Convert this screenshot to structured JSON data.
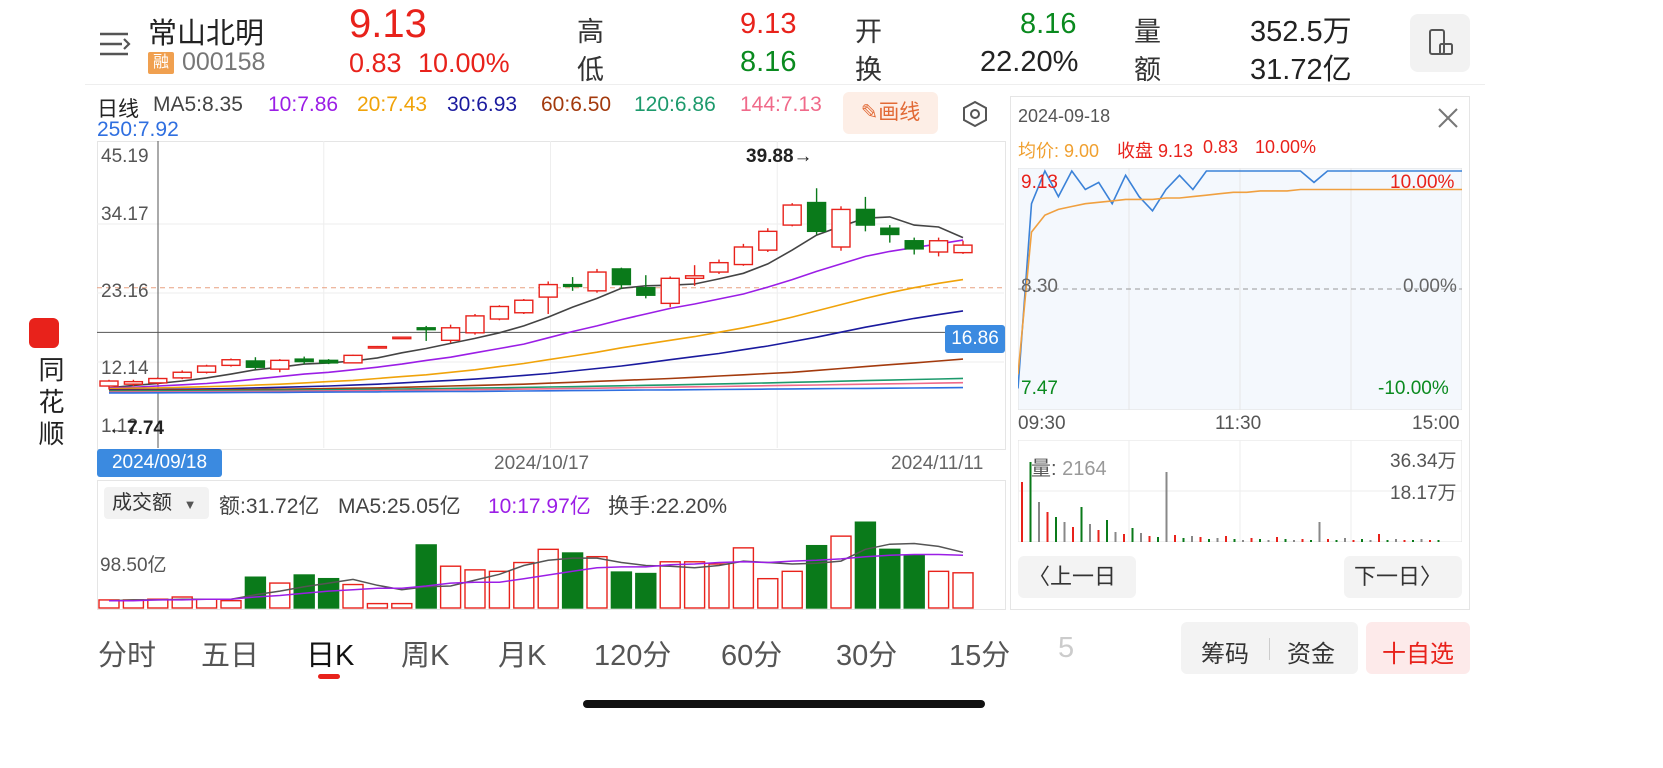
{
  "stock": {
    "name": "常山北明",
    "tag": "融",
    "code": "000158",
    "price": "9.13",
    "change": "0.83",
    "change_pct": "10.00%",
    "high_label": "高",
    "high": "9.13",
    "low_label": "低",
    "low": "8.16",
    "open_label": "开",
    "open": "8.16",
    "turnover_label": "换",
    "turnover": "22.20%",
    "volume_label": "量",
    "volume": "352.5万",
    "amount_label": "额",
    "amount": "31.72亿"
  },
  "brand": {
    "name": "同花顺"
  },
  "kline": {
    "period": "日线",
    "ma": [
      {
        "label": "MA5:8.35",
        "color": "#444444"
      },
      {
        "label": "10:7.86",
        "color": "#9b1ee6"
      },
      {
        "label": "20:7.43",
        "color": "#f0a30a"
      },
      {
        "label": "30:6.93",
        "color": "#1a1a9e"
      },
      {
        "label": "60:6.50",
        "color": "#a33a0d"
      },
      {
        "label": "120:6.86",
        "color": "#1d9a6c"
      },
      {
        "label": "144:7.13",
        "color": "#f06a8a"
      }
    ],
    "ma250": {
      "label": "250:7.92",
      "color": "#2f6fe0"
    },
    "draw_button": "画线",
    "y_ticks": [
      "45.19",
      "34.17",
      "23.16",
      "12.14",
      "1.12"
    ],
    "max_label": "39.88→",
    "min_label": "←7.74",
    "crosshair_value": "16.86",
    "dates": [
      "2024/09/18",
      "2024/10/17",
      "2024/11/11"
    ],
    "volume_indicator": "成交额",
    "volume_stats": {
      "amount": "额:31.72亿",
      "ma5": "MA5:25.05亿",
      "ma10": "10:17.97亿",
      "turnover": "换手:22.20%"
    },
    "volume_tick": "98.50亿"
  },
  "chart_data": [
    {
      "type": "candlestick",
      "title": "",
      "ylim": [
        1.12,
        45.19
      ],
      "dates": [
        "2024/09/18",
        "2024/10/17",
        "2024/11/11"
      ],
      "candles": [
        {
          "o": 8.3,
          "c": 9.1,
          "h": 9.3,
          "l": 7.74
        },
        {
          "o": 8.6,
          "c": 9.0,
          "h": 9.3,
          "l": 8.3
        },
        {
          "o": 8.8,
          "c": 9.5,
          "h": 9.7,
          "l": 8.5
        },
        {
          "o": 9.6,
          "c": 10.5,
          "h": 10.8,
          "l": 9.4
        },
        {
          "o": 10.5,
          "c": 11.5,
          "h": 11.7,
          "l": 10.3
        },
        {
          "o": 11.6,
          "c": 12.5,
          "h": 12.7,
          "l": 11.4
        },
        {
          "o": 12.3,
          "c": 11.3,
          "h": 12.9,
          "l": 10.9
        },
        {
          "o": 11.0,
          "c": 12.4,
          "h": 12.6,
          "l": 10.5
        },
        {
          "o": 12.6,
          "c": 12.2,
          "h": 13.0,
          "l": 11.8
        },
        {
          "o": 12.4,
          "c": 12.0,
          "h": 12.6,
          "l": 11.8
        },
        {
          "o": 12.0,
          "c": 13.2,
          "h": 13.3,
          "l": 11.9
        },
        {
          "o": 14.5,
          "c": 14.6,
          "h": 14.7,
          "l": 14.4
        },
        {
          "o": 16.0,
          "c": 16.1,
          "h": 16.2,
          "l": 15.9
        },
        {
          "o": 17.6,
          "c": 17.3,
          "h": 17.9,
          "l": 15.5
        },
        {
          "o": 15.6,
          "c": 17.6,
          "h": 18.1,
          "l": 15.2
        },
        {
          "o": 16.8,
          "c": 19.5,
          "h": 19.8,
          "l": 16.5
        },
        {
          "o": 19.0,
          "c": 21.0,
          "h": 21.2,
          "l": 18.8
        },
        {
          "o": 20.0,
          "c": 22.0,
          "h": 22.2,
          "l": 19.8
        },
        {
          "o": 22.5,
          "c": 24.5,
          "h": 25.0,
          "l": 19.8
        },
        {
          "o": 24.5,
          "c": 24.2,
          "h": 25.7,
          "l": 23.5
        },
        {
          "o": 23.5,
          "c": 26.5,
          "h": 27.0,
          "l": 23.2
        },
        {
          "o": 27.0,
          "c": 24.5,
          "h": 27.2,
          "l": 23.8
        },
        {
          "o": 24.0,
          "c": 22.8,
          "h": 26.0,
          "l": 22.3
        },
        {
          "o": 21.5,
          "c": 25.5,
          "h": 25.8,
          "l": 20.9
        },
        {
          "o": 25.5,
          "c": 25.9,
          "h": 27.6,
          "l": 24.3
        },
        {
          "o": 26.5,
          "c": 28.0,
          "h": 28.5,
          "l": 26.2
        },
        {
          "o": 27.7,
          "c": 30.5,
          "h": 31.0,
          "l": 27.5
        },
        {
          "o": 30.0,
          "c": 33.0,
          "h": 33.5,
          "l": 29.7
        },
        {
          "o": 34.0,
          "c": 37.2,
          "h": 37.5,
          "l": 33.8
        },
        {
          "o": 37.6,
          "c": 33.0,
          "h": 39.88,
          "l": 32.5
        },
        {
          "o": 30.5,
          "c": 36.5,
          "h": 37.0,
          "l": 29.9
        },
        {
          "o": 36.5,
          "c": 34.0,
          "h": 38.5,
          "l": 33.0
        },
        {
          "o": 33.5,
          "c": 32.5,
          "h": 34.0,
          "l": 31.2
        },
        {
          "o": 31.5,
          "c": 30.2,
          "h": 32.0,
          "l": 29.3
        },
        {
          "o": 29.7,
          "c": 31.5,
          "h": 32.0,
          "l": 29.0
        },
        {
          "o": 29.6,
          "c": 30.8,
          "h": 31.5,
          "l": 29.4
        }
      ],
      "series": [
        {
          "name": "MA5",
          "color": "#444444",
          "values": [
            8.0,
            8.4,
            8.7,
            9.1,
            9.6,
            10.2,
            10.9,
            11.3,
            11.8,
            12.0,
            12.3,
            12.8,
            13.6,
            14.3,
            15.1,
            15.9,
            16.8,
            17.9,
            19.3,
            20.9,
            22.3,
            23.9,
            24.3,
            24.4,
            24.6,
            25.4,
            26.3,
            27.8,
            30.0,
            32.4,
            33.8,
            35.1,
            35.3,
            34.0,
            33.7,
            32.0
          ]
        },
        {
          "name": "MA10",
          "color": "#9b1ee6",
          "values": [
            8.0,
            8.1,
            8.3,
            8.5,
            8.7,
            9.0,
            9.4,
            9.8,
            10.2,
            10.5,
            10.9,
            11.3,
            11.8,
            12.4,
            12.9,
            13.6,
            14.3,
            15.0,
            16.0,
            17.0,
            17.9,
            18.9,
            19.8,
            20.7,
            21.4,
            22.2,
            23.0,
            24.1,
            25.3,
            26.6,
            27.8,
            29.0,
            29.8,
            30.4,
            31.0,
            31.6
          ]
        },
        {
          "name": "MA20",
          "color": "#f0a30a",
          "values": [
            7.9,
            7.95,
            8.0,
            8.1,
            8.2,
            8.3,
            8.45,
            8.6,
            8.8,
            9.0,
            9.2,
            9.5,
            9.8,
            10.1,
            10.5,
            10.9,
            11.4,
            11.9,
            12.5,
            13.1,
            13.7,
            14.4,
            15.0,
            15.6,
            16.2,
            16.9,
            17.6,
            18.4,
            19.3,
            20.3,
            21.3,
            22.3,
            23.2,
            24.0,
            24.7,
            25.3
          ]
        },
        {
          "name": "MA30",
          "color": "#1a1a9e",
          "values": [
            7.7,
            7.72,
            7.75,
            7.8,
            7.85,
            7.9,
            8.0,
            8.1,
            8.2,
            8.3,
            8.45,
            8.6,
            8.8,
            9.0,
            9.2,
            9.4,
            9.7,
            10.0,
            10.3,
            10.7,
            11.1,
            11.5,
            12.0,
            12.5,
            13.0,
            13.5,
            14.1,
            14.7,
            15.4,
            16.1,
            16.9,
            17.7,
            18.4,
            19.1,
            19.7,
            20.3
          ]
        },
        {
          "name": "MA60",
          "color": "#a33a0d",
          "values": [
            7.6,
            7.62,
            7.64,
            7.66,
            7.68,
            7.7,
            7.75,
            7.8,
            7.85,
            7.9,
            7.95,
            8.0,
            8.1,
            8.2,
            8.3,
            8.4,
            8.5,
            8.6,
            8.75,
            8.9,
            9.05,
            9.2,
            9.35,
            9.5,
            9.7,
            9.9,
            10.1,
            10.3,
            10.5,
            10.8,
            11.1,
            11.4,
            11.7,
            12.0,
            12.3,
            12.6
          ]
        },
        {
          "name": "MA120",
          "color": "#1d9a6c",
          "values": [
            7.5,
            7.51,
            7.52,
            7.53,
            7.55,
            7.57,
            7.6,
            7.63,
            7.66,
            7.7,
            7.74,
            7.78,
            7.82,
            7.87,
            7.92,
            7.97,
            8.02,
            8.08,
            8.14,
            8.2,
            8.27,
            8.34,
            8.41,
            8.48,
            8.56,
            8.64,
            8.72,
            8.8,
            8.89,
            8.98,
            9.07,
            9.16,
            9.25,
            9.34,
            9.43,
            9.52
          ]
        },
        {
          "name": "MA144",
          "color": "#f06a8a",
          "values": [
            7.35,
            7.36,
            7.37,
            7.38,
            7.4,
            7.42,
            7.44,
            7.46,
            7.49,
            7.52,
            7.55,
            7.58,
            7.61,
            7.65,
            7.69,
            7.73,
            7.77,
            7.81,
            7.86,
            7.91,
            7.96,
            8.01,
            8.06,
            8.11,
            8.17,
            8.23,
            8.29,
            8.35,
            8.41,
            8.47,
            8.53,
            8.59,
            8.65,
            8.71,
            8.77,
            8.83
          ]
        },
        {
          "name": "MA250",
          "color": "#2f6fe0",
          "values": [
            7.2,
            7.21,
            7.22,
            7.23,
            7.24,
            7.25,
            7.27,
            7.29,
            7.31,
            7.33,
            7.35,
            7.37,
            7.39,
            7.41,
            7.43,
            7.45,
            7.48,
            7.51,
            7.54,
            7.57,
            7.6,
            7.63,
            7.66,
            7.69,
            7.72,
            7.75,
            7.78,
            7.81,
            7.84,
            7.87,
            7.9,
            7.93,
            7.96,
            7.99,
            8.02,
            8.05
          ]
        }
      ],
      "reference_lines": [
        {
          "value": 24.0,
          "style": "dashed",
          "color": "#e8a080"
        },
        {
          "value": 16.86,
          "style": "solid",
          "color": "#555555"
        }
      ]
    },
    {
      "type": "bar",
      "title": "",
      "ylabel": "",
      "ylim": [
        0,
        98.5
      ],
      "values": [
        11,
        11,
        12,
        15,
        12,
        10,
        42,
        34,
        45,
        40,
        32,
        6,
        6,
        86,
        57,
        52,
        50,
        62,
        80,
        75,
        70,
        49,
        47,
        63,
        63,
        60,
        82,
        40,
        50,
        85,
        98,
        117,
        80,
        72,
        50,
        48
      ],
      "colors": [
        "red",
        "red",
        "red",
        "red",
        "red",
        "red",
        "green",
        "red",
        "green",
        "green",
        "red",
        "red",
        "red",
        "green",
        "red",
        "red",
        "red",
        "red",
        "red",
        "green",
        "red",
        "green",
        "green",
        "red",
        "red",
        "red",
        "red",
        "red",
        "red",
        "green",
        "red",
        "green",
        "green",
        "green",
        "red",
        "red"
      ],
      "series": [
        {
          "name": "MA5",
          "color": "#555555",
          "values": [
            10,
            11,
            11,
            12,
            12,
            12,
            18,
            23,
            29,
            34,
            39,
            31,
            25,
            29,
            30,
            38,
            46,
            58,
            65,
            68,
            68,
            62,
            58,
            57,
            55,
            58,
            64,
            62,
            60,
            61,
            64,
            80,
            87,
            88,
            84,
            76
          ]
        },
        {
          "name": "10",
          "color": "#9b1ee6",
          "values": [
            10,
            10,
            11,
            11,
            12,
            12,
            15,
            17,
            20,
            23,
            25,
            27,
            27,
            30,
            34,
            35,
            35,
            40,
            45,
            50,
            55,
            56,
            56,
            59,
            60,
            62,
            63,
            62,
            64,
            65,
            67,
            70,
            72,
            73,
            73,
            72
          ]
        }
      ]
    },
    {
      "type": "line",
      "title": "",
      "date": "2024-09-18",
      "avg_label": "均价: 9.00",
      "close_label": "收盘 9.13",
      "change": "0.83",
      "change_pct": "10.00%",
      "y_left": [
        "9.13",
        "8.30",
        "7.47"
      ],
      "y_right": [
        "10.00%",
        "0.00%",
        "-10.00%"
      ],
      "x_ticks": [
        "09:30",
        "11:30",
        "15:00"
      ],
      "ylim": [
        7.47,
        9.13
      ],
      "series": [
        {
          "name": "price",
          "color": "#3b82d8",
          "values": [
            7.6,
            8.9,
            9.13,
            8.95,
            9.13,
            9.0,
            9.05,
            8.9,
            9.1,
            8.95,
            8.85,
            9.0,
            9.1,
            9.0,
            9.13,
            9.13,
            9.13,
            9.13,
            9.13,
            9.13,
            9.13,
            9.13,
            9.05,
            9.13,
            9.13,
            9.13,
            9.13,
            9.13,
            9.13,
            9.13,
            9.13,
            9.13,
            9.13,
            9.13
          ]
        },
        {
          "name": "avg",
          "color": "#f0a040",
          "values": [
            7.7,
            8.7,
            8.82,
            8.86,
            8.88,
            8.9,
            8.91,
            8.92,
            8.93,
            8.93,
            8.93,
            8.94,
            8.94,
            8.95,
            8.96,
            8.97,
            8.98,
            8.98,
            8.99,
            8.99,
            8.99,
            9.0,
            9.0,
            9.0,
            9.0,
            9.0,
            9.0,
            9.0,
            9.0,
            9.0,
            9.0,
            9.0,
            9.0,
            9.0
          ]
        }
      ]
    },
    {
      "type": "bar",
      "title": "",
      "volume_label": "量: 2164",
      "y_ticks": [
        "36.34万",
        "18.17万"
      ]
    }
  ],
  "intraday": {
    "date": "2024-09-18",
    "avg": "均价: 9.00",
    "close": "收盘 9.13",
    "change": "0.83",
    "change_pct": "10.00%",
    "y_top": "9.13",
    "y_mid": "8.30",
    "y_bot": "7.47",
    "pct_top": "10.00%",
    "pct_mid": "0.00%",
    "pct_bot": "-10.00%",
    "t_start": "09:30",
    "t_mid": "11:30",
    "t_end": "15:00",
    "vol_label": "量:",
    "vol_value": "2164",
    "vol_top": "36.34万",
    "vol_mid": "18.17万",
    "prev_button": "上一日",
    "next_button": "下一日"
  },
  "tabs": [
    "分时",
    "五日",
    "日K",
    "周K",
    "月K",
    "120分",
    "60分",
    "30分",
    "15分",
    "5"
  ],
  "active_tab": "日K",
  "bottom_buttons": {
    "chips": "筹码",
    "funds": "资金",
    "watchlist": "十自选"
  },
  "colors": {
    "up": "#e8221b",
    "down": "#0a7a1a",
    "accent_blue": "#3b82d8"
  }
}
